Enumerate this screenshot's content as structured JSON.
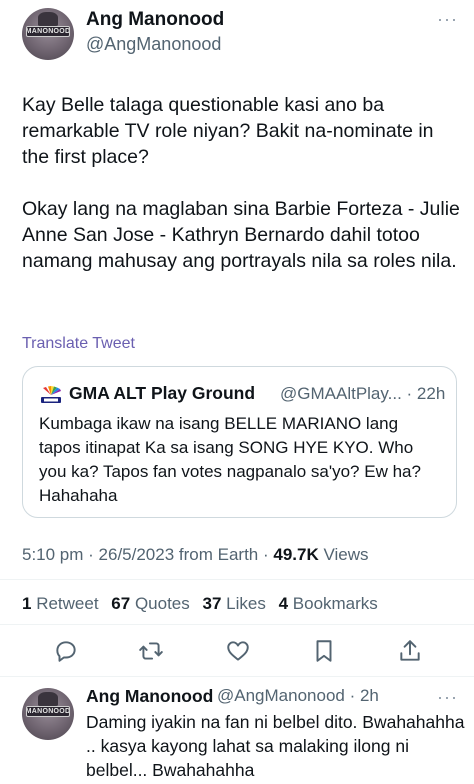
{
  "tweet": {
    "author_name": "Ang Manonood",
    "author_handle": "@AngManonood",
    "avatar_text": "MANONOOD",
    "paragraphs": [
      "Kay Belle talaga questionable kasi ano ba remarkable TV role niyan? Bakit na-nominate in the first place?",
      "Okay lang na maglaban sina Barbie Forteza - Julie Anne San Jose - Kathryn Bernardo dahil totoo namang mahusay ang portrayals nila sa roles nila."
    ],
    "translate_label": "Translate Tweet",
    "more_icon": "···"
  },
  "quote": {
    "name": "GMA ALT Play Ground",
    "handle_time": "@GMAAltPlay... · 22h",
    "text": "Kumbaga ikaw na isang BELLE MARIANO lang tapos itinapat Ka sa isang SONG HYE KYO. Who you ka? Tapos fan votes nagpanalo sa'yo? Ew ha? Hahahaha",
    "logo_icon": "gma-network-logo-icon"
  },
  "meta": {
    "time_date_source": "5:10 pm · 26/5/2023 from Earth · ",
    "views_count": "49.7K",
    "views_label": " Views"
  },
  "stats": {
    "retweets_count": "1",
    "retweets_label": " Retweet",
    "quotes_count": "67",
    "quotes_label": " Quotes",
    "likes_count": "37",
    "likes_label": " Likes",
    "bookmarks_count": "4",
    "bookmarks_label": " Bookmarks"
  },
  "actions": [
    "reply-icon",
    "retweet-icon",
    "like-icon",
    "bookmark-icon",
    "share-icon"
  ],
  "reply": {
    "author_name": "Ang Manonood",
    "handle_time": "@AngManonood · 2h",
    "text": "Daming iyakin na fan ni belbel dito. Bwahahahha .. kasya kayong lahat sa malaking ilong ni belbel... Bwahahahha"
  },
  "colors": {
    "text_primary": "#0f1419",
    "text_secondary": "#536471",
    "translate_link": "#6a5fb0",
    "border": "#cfd9de"
  }
}
